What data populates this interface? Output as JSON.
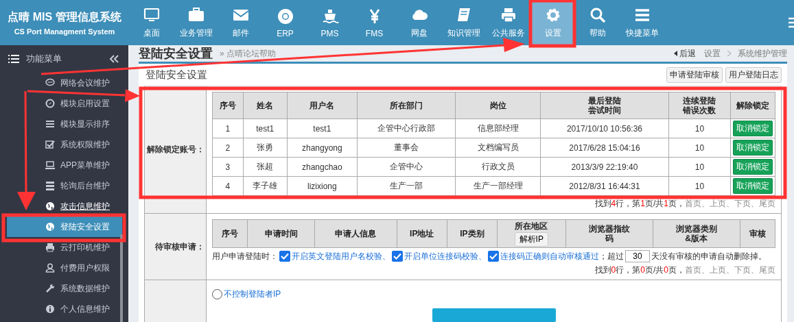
{
  "header": {
    "title": "点晴 MIS 管理信息系统",
    "subtitle": "CS Port Managment System"
  },
  "nav": [
    {
      "label": "桌面",
      "selected": false
    },
    {
      "label": "业务管理",
      "selected": false
    },
    {
      "label": "邮件",
      "selected": false
    },
    {
      "label": "ERP",
      "selected": false
    },
    {
      "label": "PMS",
      "selected": false
    },
    {
      "label": "FMS",
      "selected": false
    },
    {
      "label": "网盘",
      "selected": false
    },
    {
      "label": "知识管理",
      "selected": false
    },
    {
      "label": "公共服务",
      "selected": false
    },
    {
      "label": "设置",
      "selected": true
    },
    {
      "label": "帮助",
      "selected": false
    },
    {
      "label": "快捷菜单",
      "selected": false
    }
  ],
  "sidebar": {
    "title": "功能菜单",
    "items": [
      {
        "label": "网络会议维护",
        "selected": false,
        "hovered": false
      },
      {
        "label": "模块启用设置",
        "selected": false,
        "hovered": false
      },
      {
        "label": "模块显示排序",
        "selected": false,
        "hovered": false
      },
      {
        "label": "系统权限维护",
        "selected": false,
        "hovered": false
      },
      {
        "label": "APP菜单维护",
        "selected": false,
        "hovered": false
      },
      {
        "label": "轮询后台维护",
        "selected": false,
        "hovered": false
      },
      {
        "label": "攻击信息维护",
        "selected": false,
        "hovered": true
      },
      {
        "label": "登陆安全设置",
        "selected": true,
        "hovered": false
      },
      {
        "label": "云打印机维护",
        "selected": false,
        "hovered": false
      },
      {
        "label": "付费用户权限",
        "selected": false,
        "hovered": false
      },
      {
        "label": "系统数据维护",
        "selected": false,
        "hovered": false
      },
      {
        "label": "个人信息维护",
        "selected": false,
        "hovered": false
      }
    ]
  },
  "page": {
    "title": "登陆安全设置",
    "help_link": "» 点晴论坛帮助",
    "back": "后退",
    "breadcrumb": [
      "设置",
      "系统维护管理"
    ]
  },
  "panel": {
    "title": "登陆安全设置",
    "buttons": [
      "申请登陆审核",
      "用户登陆日志"
    ]
  },
  "locked": {
    "label": "解除锁定账号：",
    "columns": [
      "序号",
      "姓名",
      "用户名",
      "所在部门",
      "岗位",
      "最后登陆尝试时间",
      "连续登陆错误次数",
      "解除锁定"
    ],
    "rows": [
      {
        "cells": [
          "1",
          "test1",
          "test1",
          "企管中心行政部",
          "信息部经理",
          "2017/10/10 10:56:36",
          "10"
        ],
        "action": "取消锁定"
      },
      {
        "cells": [
          "2",
          "张勇",
          "zhangyong",
          "董事会",
          "文档编写员",
          "2017/6/28 15:04:16",
          "10"
        ],
        "action": "取消锁定"
      },
      {
        "cells": [
          "3",
          "张超",
          "zhangchao",
          "企管中心",
          "行政文员",
          "2013/3/9 22:19:40",
          "10"
        ],
        "action": "取消锁定"
      },
      {
        "cells": [
          "4",
          "李子雄",
          "lizixiong",
          "生产一部",
          "生产一部经理",
          "2012/8/31 16:44:31",
          "10"
        ],
        "action": "取消锁定"
      }
    ],
    "pager": [
      {
        "kind": "text",
        "text": "找到"
      },
      {
        "kind": "num",
        "text": "4"
      },
      {
        "kind": "text",
        "text": "行，第"
      },
      {
        "kind": "num",
        "text": "1"
      },
      {
        "kind": "text",
        "text": "页/共"
      },
      {
        "kind": "num",
        "text": "1"
      },
      {
        "kind": "text",
        "text": "页，"
      },
      {
        "kind": "link",
        "text": "首页、上页、下页、尾页"
      }
    ]
  },
  "pending": {
    "label": "待审核申请：",
    "columns": [
      "序号",
      "申请时间",
      "申请人信息",
      "IP地址",
      "IP类别",
      "所在地区",
      "浏览器指纹码",
      "浏览器类别&版本",
      "审核"
    ],
    "parse_button": "解析IP",
    "options_intro": "用户申请登陆时：",
    "options": [
      {
        "label": "开启英文登陆用户名校验、",
        "checked": true
      },
      {
        "label": "开启单位连接码校验、",
        "checked": true
      },
      {
        "label": "连接码正确则自动审核通过",
        "checked": true
      }
    ],
    "days_before": "；超过",
    "days": "30",
    "days_after": "天没有审核的申请自动删除掉。",
    "pager": [
      {
        "kind": "text",
        "text": "找到"
      },
      {
        "kind": "num",
        "text": "0"
      },
      {
        "kind": "text",
        "text": "行，第"
      },
      {
        "kind": "num",
        "text": "0"
      },
      {
        "kind": "text",
        "text": "页/共"
      },
      {
        "kind": "num",
        "text": "0"
      },
      {
        "kind": "text",
        "text": "页，"
      },
      {
        "kind": "link",
        "text": "首页、上页、下页、尾页"
      }
    ]
  },
  "ip": {
    "option": {
      "label": "不控制登陆者IP",
      "selected": false
    }
  }
}
